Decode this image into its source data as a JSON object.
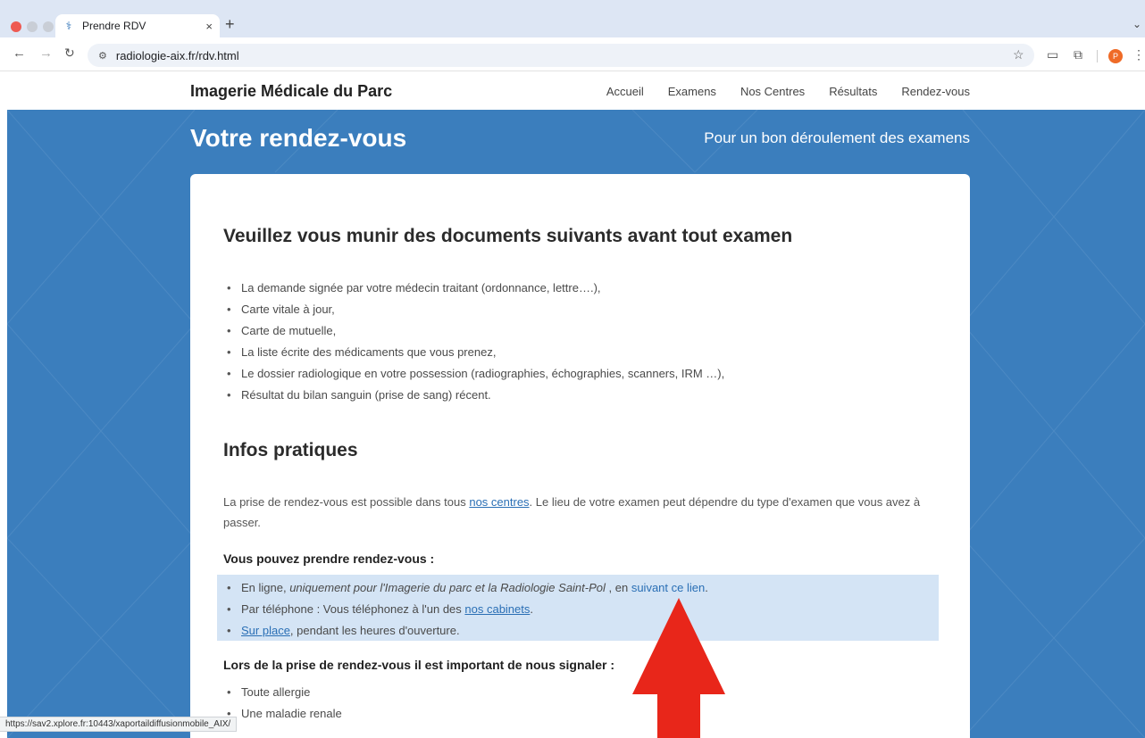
{
  "browser": {
    "tab_title": "Prendre RDV",
    "tab_close": "×",
    "new_tab": "+",
    "url": "radiologie-aix.fr/rdv.html",
    "profile_initial": "P",
    "status_url": "https://sav2.xplore.fr:10443/xaportaildiffusionmobile_AIX/"
  },
  "site": {
    "brand": "Imagerie Médicale du Parc",
    "nav": [
      "Accueil",
      "Examens",
      "Nos Centres",
      "Résultats",
      "Rendez-vous"
    ]
  },
  "hero": {
    "title": "Votre rendez-vous",
    "subtitle": "Pour un bon déroulement des examens"
  },
  "documents": {
    "heading": "Veuillez vous munir des documents suivants avant tout examen",
    "items": [
      "La demande signée par votre médecin traitant (ordonnance, lettre….),",
      "Carte vitale à jour,",
      "Carte de mutuelle,",
      "La liste écrite des médicaments que vous prenez,",
      "Le dossier radiologique en votre possession (radiographies, échographies, scanners, IRM …),",
      "Résultat du bilan sanguin (prise de sang) récent."
    ]
  },
  "infos": {
    "heading": "Infos pratiques",
    "para_before": "La prise de rendez-vous est possible dans tous ",
    "para_link": "nos centres",
    "para_after": ". Le lieu de votre examen peut dépendre du type d'examen que vous avez à passer.",
    "rdv_heading": "Vous pouvez prendre rendez-vous :",
    "online_prefix": "En ligne, ",
    "online_italic": "uniquement pour l'Imagerie du parc et la Radiologie Saint-Pol",
    "online_mid": " , en ",
    "online_link": "suivant ce lien",
    "online_end": ".",
    "phone_prefix": "Par téléphone : Vous téléphonez à l'un des ",
    "phone_link": "nos cabinets",
    "phone_end": ".",
    "onsite_link": "Sur place",
    "onsite_rest": ", pendant les heures d'ouverture.",
    "signal_heading": "Lors de la prise de rendez-vous il est important de nous signaler :",
    "signal_items": [
      "Toute allergie",
      "Une maladie renale"
    ]
  },
  "colors": {
    "hero_blue": "#3b7ebd",
    "link_blue": "#2a6fb5",
    "highlight": "#d4e4f5",
    "arrow_red": "#e8261a"
  }
}
